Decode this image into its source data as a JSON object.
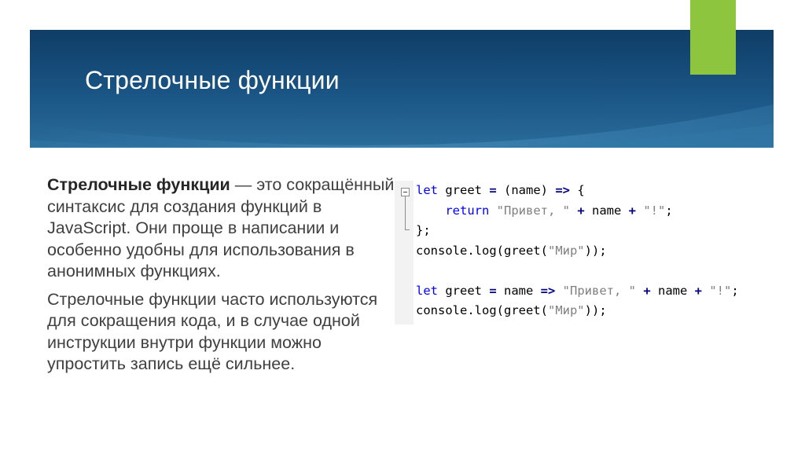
{
  "slide": {
    "title": "Стрелочные функции",
    "colors": {
      "banner": "#1a5585",
      "accent": "#8dc53f",
      "text": "#404040"
    }
  },
  "body": {
    "p1_bold": "Стрелочные функции",
    "p1_rest": " — это сокращённый синтаксис для создания функций в JavaScript. Они проще в написании и особенно удобны для использования в анонимных функциях.",
    "p2": "Стрелочные функции часто используются для сокращения кода, и в случае одной инструкции внутри функции можно упростить запись ещё сильнее."
  },
  "code": {
    "line1": {
      "kw": "let",
      "a": " greet ",
      "op1": "=",
      "b": " (name) ",
      "op2": "=>",
      "c": " {"
    },
    "line2": {
      "indent": "    ",
      "kw": "return",
      "s1": " \"Привет, \" ",
      "op1": "+",
      "a": " name ",
      "op2": "+",
      "s2": " \"!\"",
      "end": ";"
    },
    "line3": {
      "text": "};"
    },
    "line4": {
      "a": "console.log(greet(",
      "s": "\"Мир\"",
      "end": "));"
    },
    "line6": {
      "kw": "let",
      "a": " greet ",
      "op1": "=",
      "b": " name ",
      "op2": "=>",
      "s1": " \"Привет, \" ",
      "op3": "+",
      "c": " name ",
      "op4": "+",
      "s2": " \"!\"",
      "end": ";"
    },
    "line7": {
      "a": "console.log(greet(",
      "s": "\"Мир\"",
      "end": "));"
    }
  }
}
